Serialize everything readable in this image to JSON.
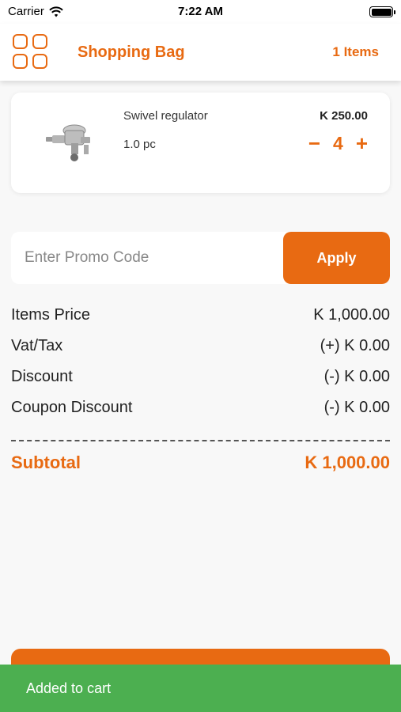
{
  "status_bar": {
    "carrier": "Carrier",
    "time": "7:22 AM"
  },
  "header": {
    "title": "Shopping Bag",
    "item_count": "1 Items",
    "menu_icon": "grid-icon"
  },
  "cart": {
    "items": [
      {
        "name": "Swivel regulator",
        "unit_qty": "1.0 pc",
        "price": "K 250.00",
        "quantity": "4",
        "minus": "−",
        "plus": "+"
      }
    ]
  },
  "promo": {
    "placeholder": "Enter Promo Code",
    "value": "",
    "apply_label": "Apply"
  },
  "summary": {
    "rows": [
      {
        "label": "Items Price",
        "value": "K 1,000.00"
      },
      {
        "label": "Vat/Tax",
        "value": "(+) K 0.00"
      },
      {
        "label": "Discount",
        "value": "(-) K 0.00"
      },
      {
        "label": "Coupon Discount",
        "value": "(-) K 0.00"
      }
    ],
    "subtotal_label": "Subtotal",
    "subtotal_value": "K 1,000.00"
  },
  "snackbar": {
    "message": "Added to cart"
  },
  "colors": {
    "accent": "#e86a12",
    "success": "#4caf50",
    "background": "#f8f8f8"
  }
}
